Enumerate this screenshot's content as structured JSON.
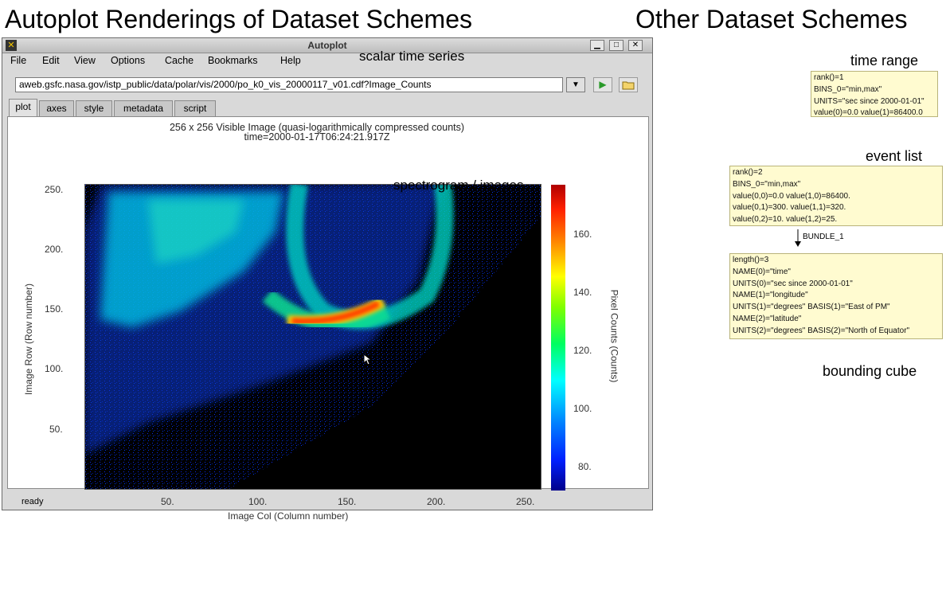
{
  "slide": {
    "left_title": "Autoplot Renderings of Dataset Schemes",
    "right_title": "Other Dataset Schemes",
    "label_scalar_time_series": "scalar time series",
    "label_spectrogram": "spectrogram / images",
    "label_time_range": "time range",
    "label_event_list": "event list",
    "label_bounding_cube": "bounding cube",
    "bundle_label": "BUNDLE_1"
  },
  "window": {
    "title": "Autoplot",
    "menu": [
      "File",
      "Edit",
      "View",
      "Options",
      "Cache",
      "Bookmarks",
      "Help"
    ],
    "url": "aweb.gsfc.nasa.gov/istp_public/data/polar/vis/2000/po_k0_vis_20000117_v01.cdf?Image_Counts",
    "tabs": [
      "plot",
      "axes",
      "style",
      "metadata",
      "script"
    ],
    "active_tab": "plot",
    "status": "ready",
    "colors": {
      "chrome": "#d9d9d9",
      "image_bg": "#000000",
      "box_bg": "#fffbd0"
    }
  },
  "plot": {
    "title_line1": "256 x 256 Visible Image (quasi-logarithmically compressed counts)",
    "title_line2": "time=2000-01-17T06:24:21.917Z",
    "xlabel": "Image Col (Column number)",
    "ylabel": "Image Row (Row number)",
    "zlabel": "Pixel Counts (Counts)",
    "x_ticks": [
      "50.",
      "100.",
      "150.",
      "200.",
      "250."
    ],
    "y_ticks": [
      "250.",
      "200.",
      "150.",
      "100.",
      "50."
    ],
    "z_ticks": [
      "160.",
      "140.",
      "120.",
      "100.",
      "80."
    ]
  },
  "boxes": {
    "time_range": [
      "rank()=1",
      "BINS_0=\"min,max\"",
      "UNITS=\"sec since 2000-01-01\"",
      "value(0)=0.0  value(1)=86400.0"
    ],
    "event_list": [
      "rank()=2",
      "BINS_0=\"min,max\"",
      "value(0,0)=0.0     value(1,0)=86400.",
      "value(0,1)=300.   value(1,1)=320.",
      "value(0,2)=10.     value(1,2)=25."
    ],
    "bundle": [
      "length()=3",
      "NAME(0)=\"time\"",
      "UNITS(0)=\"sec since 2000-01-01\"",
      "NAME(1)=\"longitude\"",
      "UNITS(1)=\"degrees\" BASIS(1)=\"East of PM\"",
      "NAME(2)=\"latitude\"",
      "UNITS(2)=\"degrees\" BASIS(2)=\"North of Equator\""
    ]
  }
}
